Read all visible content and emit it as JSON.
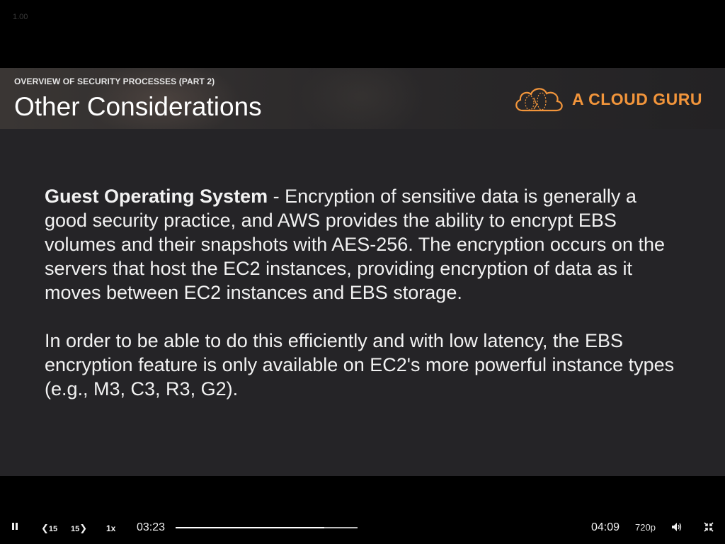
{
  "overlay": {
    "corner_label": "1.00"
  },
  "slide": {
    "section": "OVERVIEW OF SECURITY PROCESSES (PART 2)",
    "title": "Other Considerations",
    "brand": "A CLOUD GURU",
    "brand_color": "#f2953b",
    "paragraph1_bold": "Guest Operating System",
    "paragraph1_rest": " - Encryption of sensitive data is generally a good security practice, and AWS provides the ability to encrypt EBS volumes and their snapshots with AES-256. The encryption occurs on the servers that host the EC2 instances, providing encryption of data as it moves between EC2 instances and EBS storage.",
    "paragraph2": "In order to be able to do this efficiently and with low latency, the EBS encryption feature is only available on EC2's more powerful instance types (e.g., M3, C3, R3, G2)."
  },
  "player": {
    "pause_icon": "pause-icon",
    "rewind_label": "15",
    "forward_label": "15",
    "speed": "1x",
    "current_time": "03:23",
    "duration": "04:09",
    "progress_fraction": 0.8153,
    "quality": "720p",
    "volume_icon": "volume-icon",
    "exit_fullscreen_icon": "exit-fullscreen-icon"
  }
}
